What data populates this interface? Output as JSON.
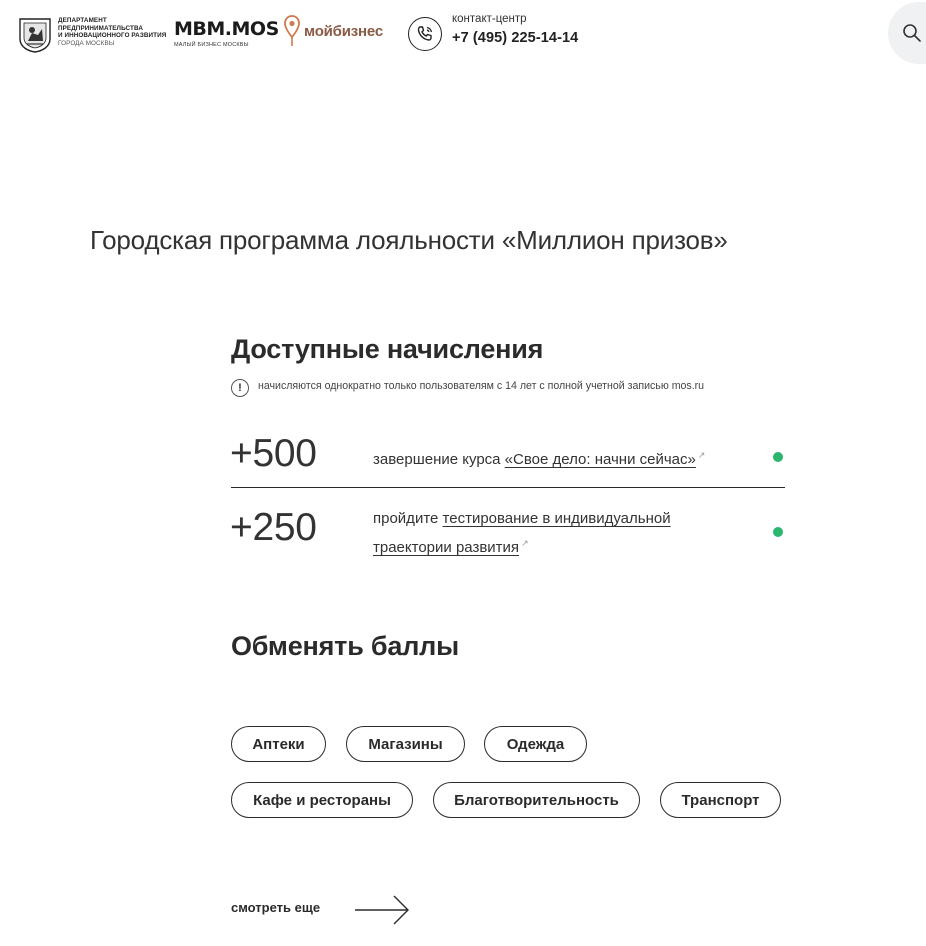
{
  "header": {
    "dept": {
      "line1": "Департамент",
      "line2": "предпринимательства",
      "line3": "и инновационного развития",
      "line4": "города Москвы"
    },
    "mbm": {
      "name": "MBM.MOS",
      "subtitle": "малый бизнес москвы"
    },
    "moi_biznes": {
      "name": "мойбизнес"
    },
    "contact": {
      "label": "контакт-центр",
      "phone": "+7 (495) 225-14-14"
    },
    "icons": {
      "phone": "phone-icon",
      "search": "search-icon",
      "crest": "moscow-crest-icon",
      "pin": "map-pin-icon"
    }
  },
  "page_title": "Городская программа лояльности «Миллион призов»",
  "accruals": {
    "heading": "Доступные начисления",
    "note": "начисляются однократно только пользователям с 14 лет с полной учетной записью mos.ru",
    "items": [
      {
        "points": "+500",
        "text_before": "завершение курса ",
        "link": "«Свое дело: начни сейчас»",
        "status_color": "#2ab66e"
      },
      {
        "points": "+250",
        "text_before": "пройдите ",
        "link": "тестирование в индивидуальной траектории развития",
        "status_color": "#2ab66e"
      }
    ]
  },
  "exchange": {
    "heading": "Обменять баллы",
    "categories": [
      "Аптеки",
      "Магазины",
      "Одежда",
      "Кафе и рестораны",
      "Благотворительность",
      "Транспорт"
    ],
    "more_label": "смотреть еще"
  },
  "colors": {
    "accent_green": "#2ab66e",
    "brand_brown": "#8a5a44",
    "text": "#2b2b2b"
  }
}
